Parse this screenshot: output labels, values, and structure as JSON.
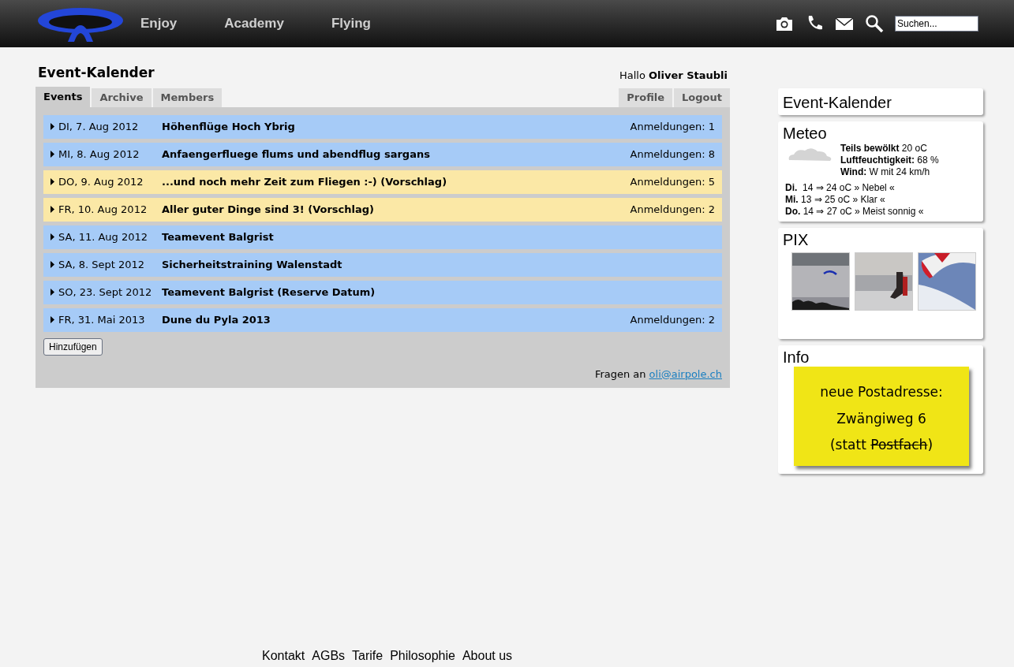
{
  "nav": {
    "links": [
      "Enjoy",
      "Academy",
      "Flying"
    ],
    "search": {
      "placeholder": "Suchen..."
    }
  },
  "main": {
    "title": "Event-Kalender",
    "greeting": "Hallo **Oliver Staubli**",
    "tabs_left": [
      {
        "label": "Events",
        "selected": true
      },
      {
        "label": "Archive",
        "selected": false
      },
      {
        "label": "Members",
        "selected": false
      }
    ],
    "tabs_right": [
      {
        "label": "Profile",
        "selected": false
      },
      {
        "label": "Logout",
        "selected": false
      }
    ],
    "events": [
      {
        "date": "DI, 7. Aug 2012",
        "title": "Höhenflüge Hoch Ybrig",
        "registrations": "Anmeldungen: 1",
        "color": "#a6cbf7"
      },
      {
        "date": "MI, 8. Aug 2012",
        "title": "Anfaengerfluege flums und abendflug sargans",
        "registrations": "Anmeldungen: 8",
        "color": "#a6cbf7"
      },
      {
        "date": "DO, 9. Aug 2012",
        "title": "...und noch mehr Zeit zum Fliegen :-) (Vorschlag)",
        "registrations": "Anmeldungen: 5",
        "color": "#fbe8a6"
      },
      {
        "date": "FR, 10. Aug 2012",
        "title": "Aller guter Dinge sind 3! (Vorschlag)",
        "registrations": "Anmeldungen: 2",
        "color": "#fbe8a6"
      },
      {
        "date": "SA, 11. Aug 2012",
        "title": "Teamevent Balgrist",
        "color": "#a6cbf7"
      },
      {
        "date": "SA, 8. Sept 2012",
        "title": "Sicherheitstraining Walenstadt",
        "color": "#a6cbf7"
      },
      {
        "date": "SO, 23. Sept 2012",
        "title": "Teamevent Balgrist (Reserve Datum)",
        "color": "#a6cbf7"
      },
      {
        "date": "FR, 31. Mai 2013",
        "title": "Dune du Pyla 2013",
        "registrations": "Anmeldungen: 2",
        "color": "#a6cbf7"
      }
    ],
    "add_button": "Hinzufügen",
    "contact_text": "Fragen an",
    "contact_link": "oli@airpole.ch"
  },
  "sidebar": {
    "calendar_title": "Event-Kalender",
    "meteo": {
      "title": "Meteo",
      "current": [
        "**Teils bewölkt** 20 oC",
        "**Luftfeuchtigkeit:** 68 %",
        "**Wind:** W mit 24 km/h"
      ],
      "forecast": [
        "**Di.**  14 ⇒ 24 oC » Nebel «",
        "**Mi.** 13 ⇒ 25 oC » Klar «",
        "**Do.** 14 ⇒ 27 oC » Meist sonnig «"
      ]
    },
    "pix": {
      "title": "PIX"
    },
    "info": {
      "title": "Info",
      "note_lines": [
        {
          "text": "neue Postadresse:"
        },
        {
          "text": "Zwängiweg 6"
        },
        {
          "text": "(statt ",
          "struck": "Postfach",
          "after": ")"
        }
      ]
    }
  },
  "footer": [
    "Kontakt",
    "AGBs",
    "Tarife",
    "Philosophie",
    "About us"
  ]
}
